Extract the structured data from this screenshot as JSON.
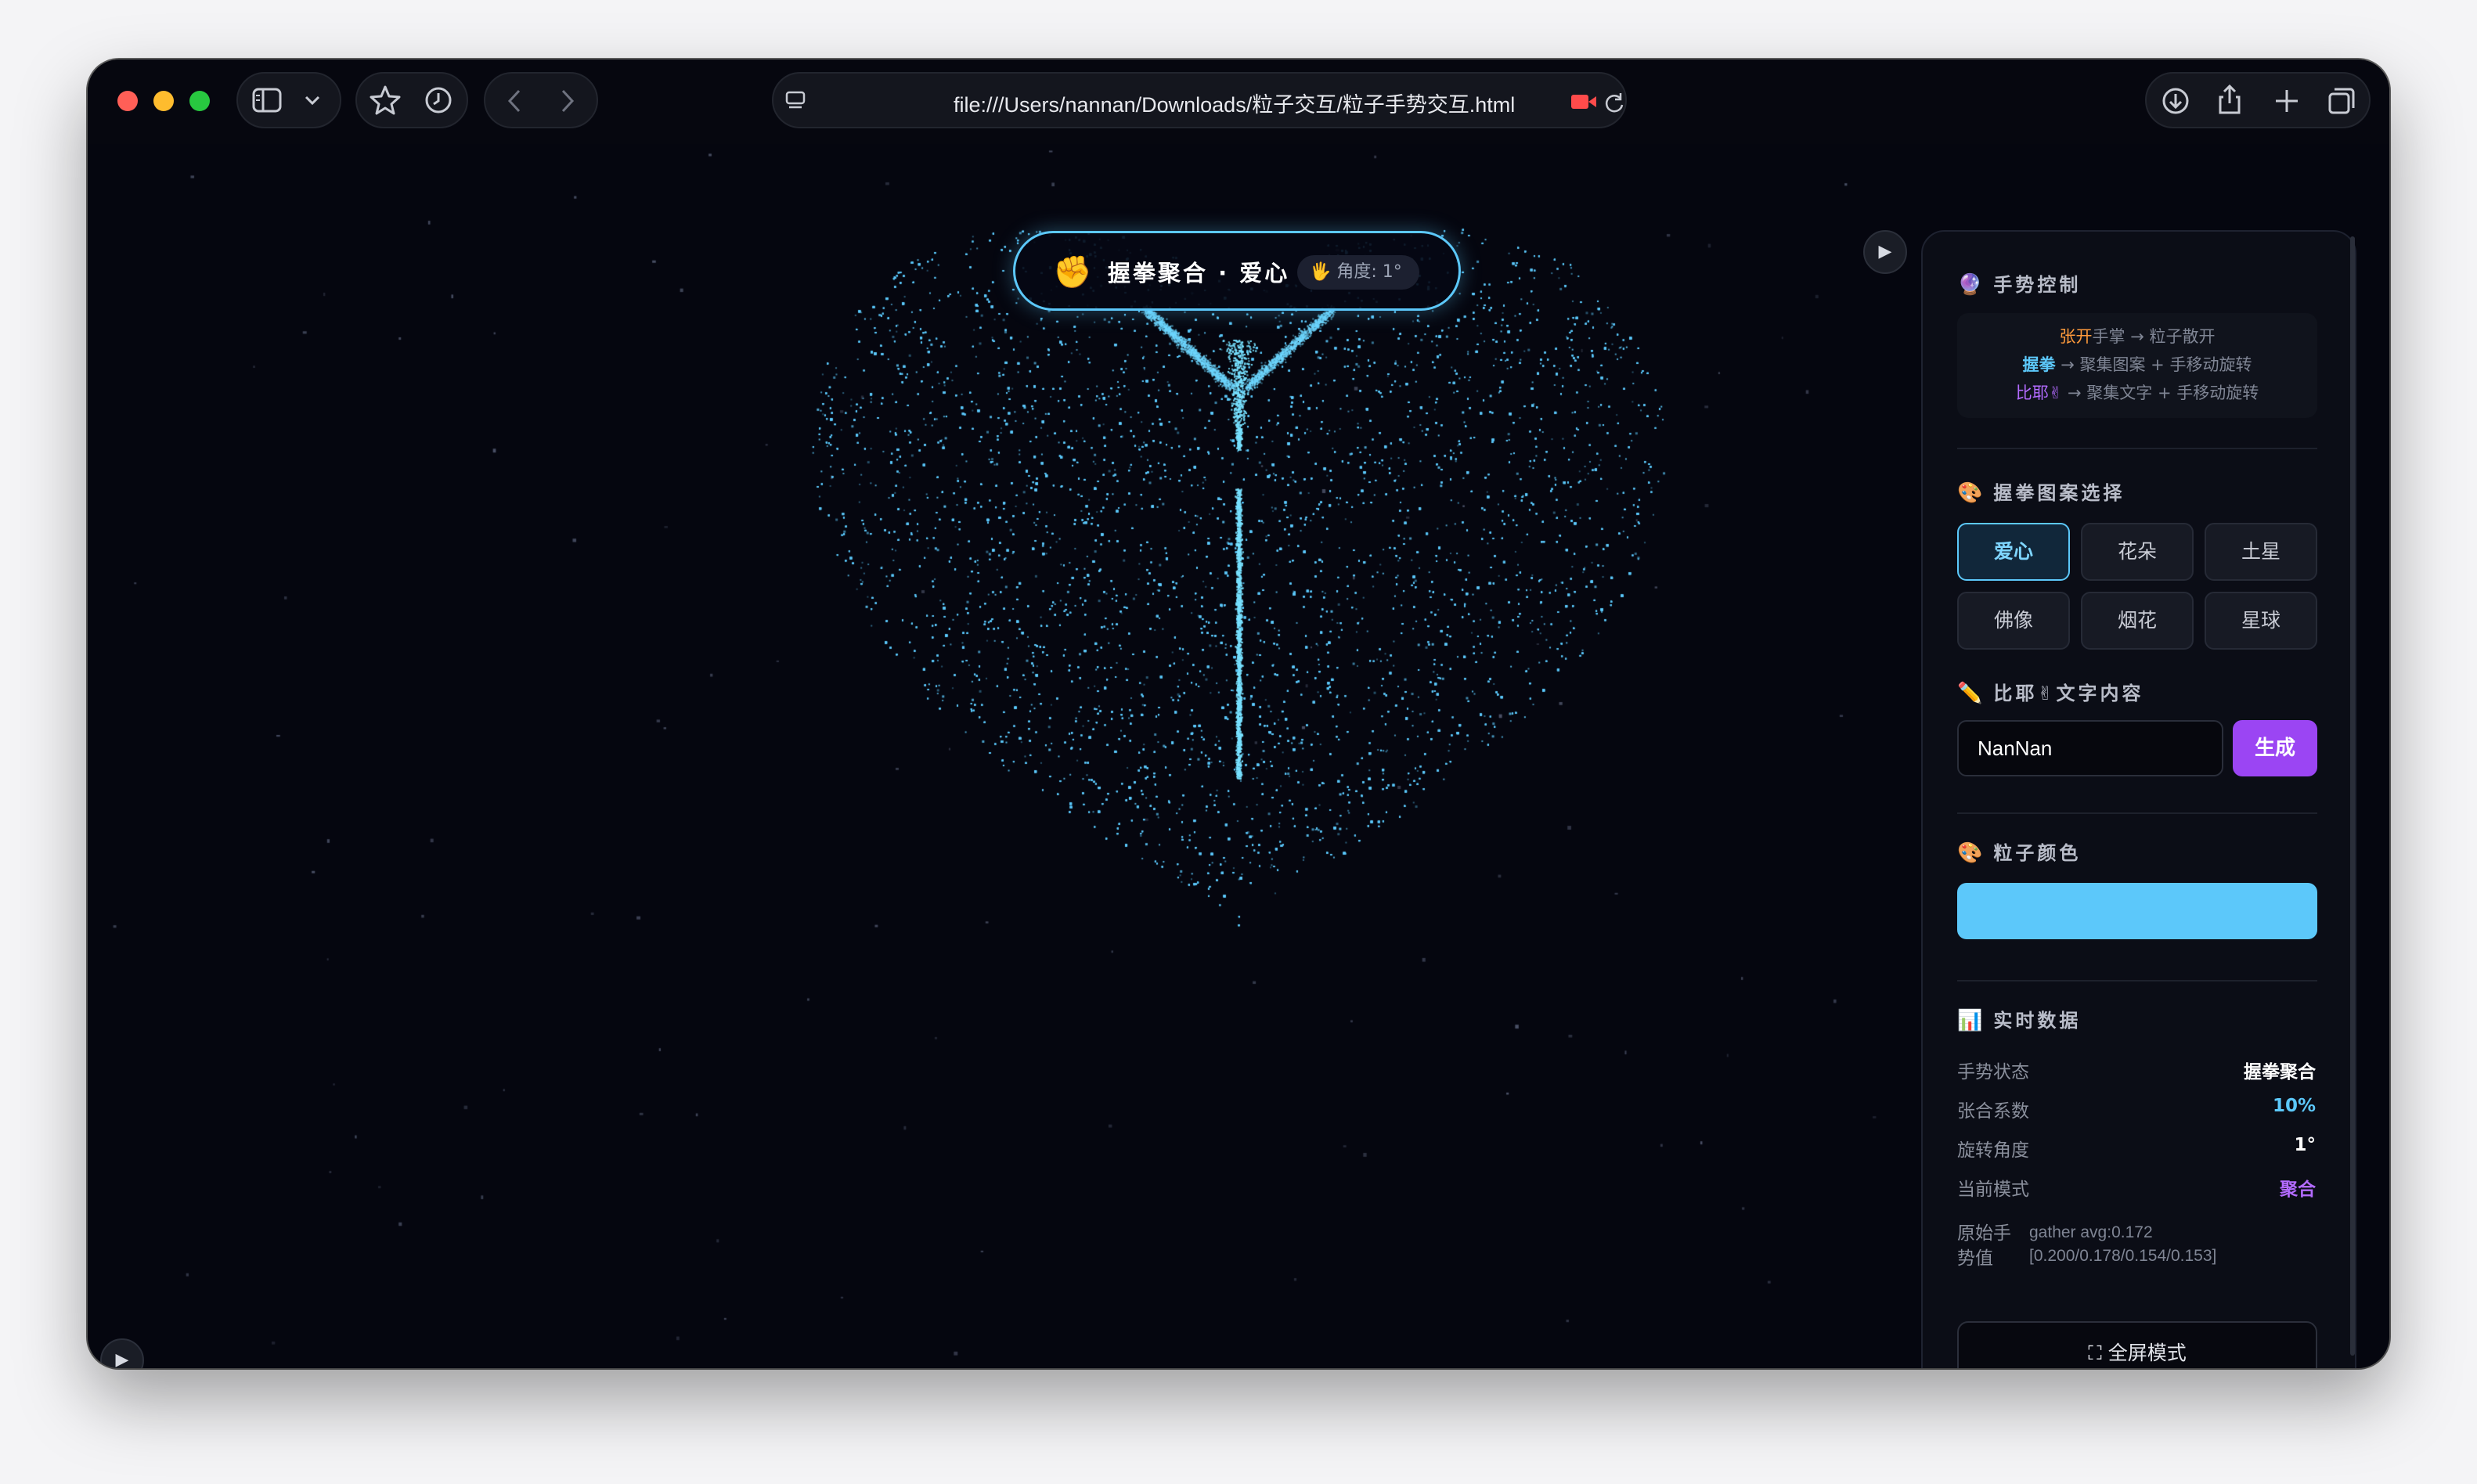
{
  "browser": {
    "url": "file:///Users/nannan/Downloads/粒子交互/粒子手势交互.html"
  },
  "status": {
    "emoji": "✊",
    "text": "握拳聚合 · 爱心",
    "angle_badge": "🖐 角度: 1°"
  },
  "colors": {
    "accent": "#5cc8fa",
    "particle": "#5cc8fa",
    "purple": "#9b45f3",
    "orange": "#ff9a3c",
    "bg": "#05060f"
  },
  "panel": {
    "gesture_section": {
      "icon": "🔮",
      "title": "手势控制",
      "lines": [
        {
          "keyword": "张开",
          "rest": "手掌 → 粒子散开"
        },
        {
          "keyword": "握拳",
          "rest": " → 聚集图案 + 手移动旋转"
        },
        {
          "keyword": "比耶✌",
          "rest": " → 聚集文字 + 手移动旋转"
        }
      ]
    },
    "shape_section": {
      "icon": "🎨",
      "title": "握拳图案选择",
      "options": [
        "爱心",
        "花朵",
        "土星",
        "佛像",
        "烟花",
        "星球"
      ],
      "selected": "爱心"
    },
    "text_section": {
      "icon": "✏️",
      "title": "比耶✌文字内容",
      "input_value": "NanNan",
      "button_label": "生成"
    },
    "color_section": {
      "icon": "🎨",
      "title": "粒子颜色"
    },
    "data_section": {
      "icon": "📊",
      "title": "实时数据",
      "rows": [
        {
          "label": "手势状态",
          "value": "握拳聚合",
          "color": "#ffffff"
        },
        {
          "label": "张合系数",
          "value": "10%",
          "color": "#5cc8fa"
        },
        {
          "label": "旋转角度",
          "value": "1°",
          "color": "#ffffff"
        },
        {
          "label": "当前模式",
          "value": "聚合",
          "color": "#b36bff"
        }
      ],
      "raw_label": "原始手势值",
      "raw_value": "gather avg:0.172 [0.200/0.178/0.154/0.153]"
    },
    "fullscreen_label": "⛶ 全屏模式"
  }
}
